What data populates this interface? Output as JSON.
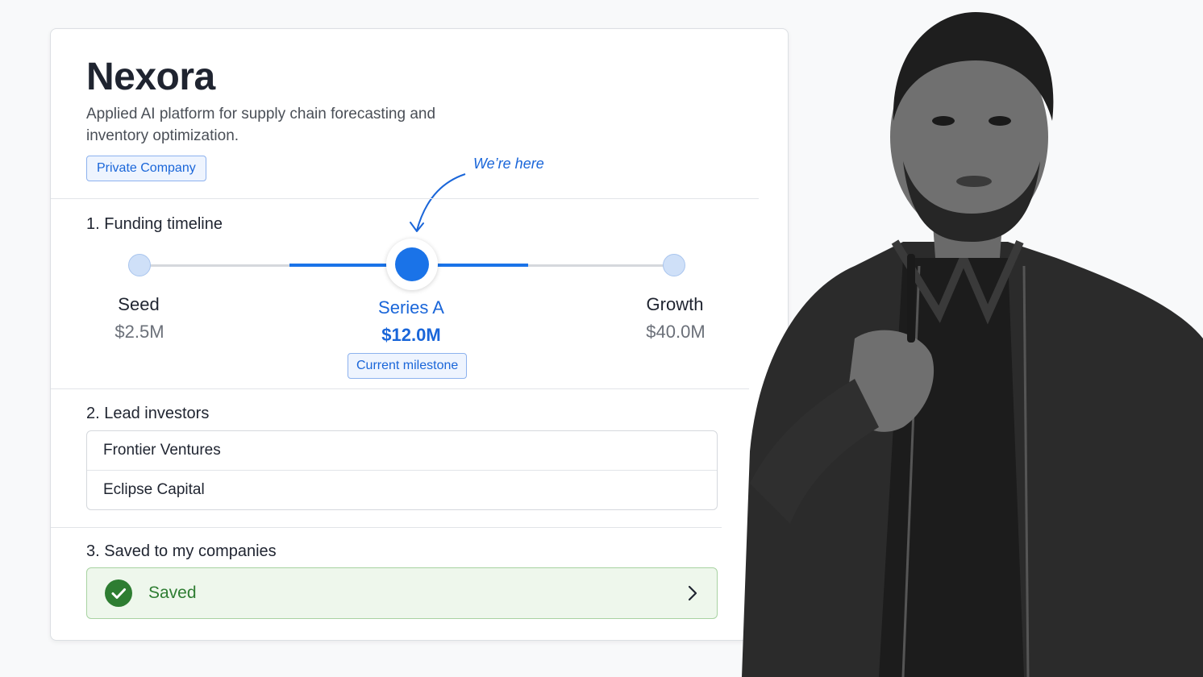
{
  "company": {
    "name": "Nexora",
    "description": "Applied AI platform for supply chain forecasting and inventory optimization.",
    "badge": "Private Company"
  },
  "annotation": {
    "text": "We’re here"
  },
  "funding": {
    "title": "1. Funding timeline",
    "stages": [
      {
        "label": "Seed",
        "amount": "$2.5M"
      },
      {
        "label": "Series A",
        "amount": "$12.0M"
      },
      {
        "label": "Growth",
        "amount": "$40.0M"
      }
    ],
    "current_badge": "Current milestone"
  },
  "investors": {
    "title": "2. Lead investors",
    "items": [
      "Frontier Ventures",
      "Eclipse Capital"
    ]
  },
  "saved": {
    "title": "3. Saved to my companies",
    "status": "Saved"
  },
  "colors": {
    "accent": "#1a73e8",
    "success": "#2e7d32",
    "success_bg": "#eef7ec"
  }
}
